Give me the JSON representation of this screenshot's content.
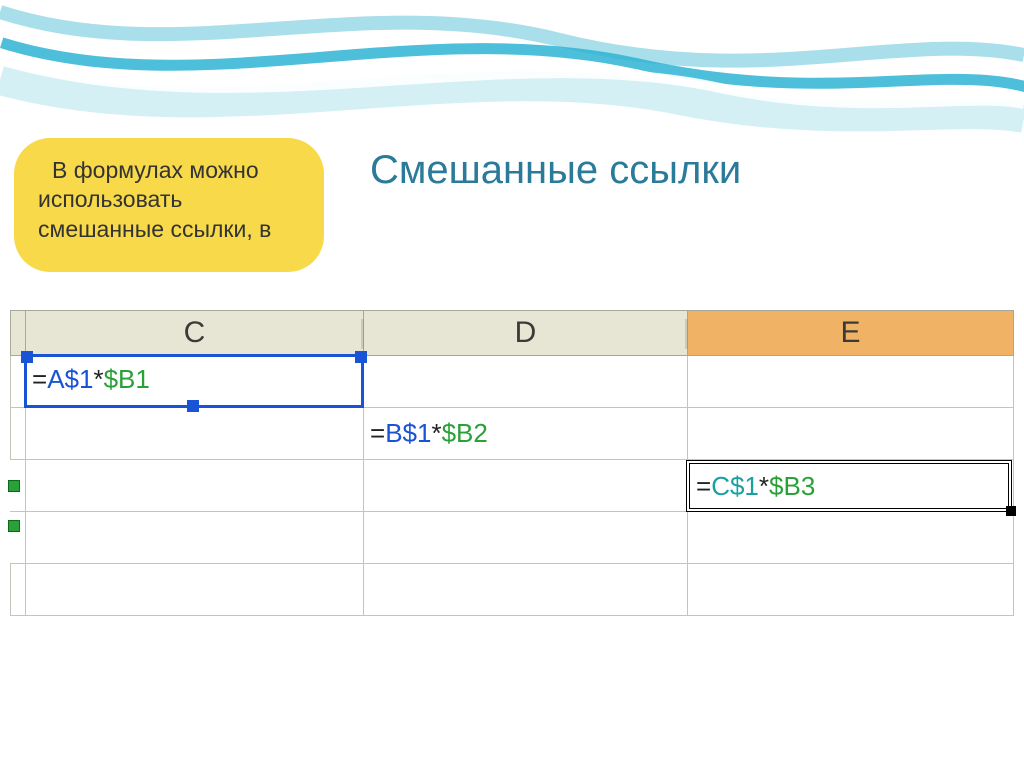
{
  "slide": {
    "title": "Смешанные ссылки",
    "callout_line1": "В формулах можно",
    "callout_line2": "использовать",
    "callout_line3": "смешанные ссылки, в"
  },
  "sheet": {
    "headers": {
      "c": "C",
      "d": "D",
      "e": "E"
    },
    "cells": {
      "r1": {
        "c_eq": "=",
        "c_ref1": "A$1",
        "c_op": "*",
        "c_ref2": "$B1"
      },
      "r2": {
        "d_eq": "=",
        "d_ref1": "B$1",
        "d_op": "*",
        "d_ref2": "$B2"
      },
      "r3": {
        "e_eq": "=",
        "e_ref1": "C$1",
        "e_op": "*",
        "e_ref2": "$B3"
      }
    }
  }
}
